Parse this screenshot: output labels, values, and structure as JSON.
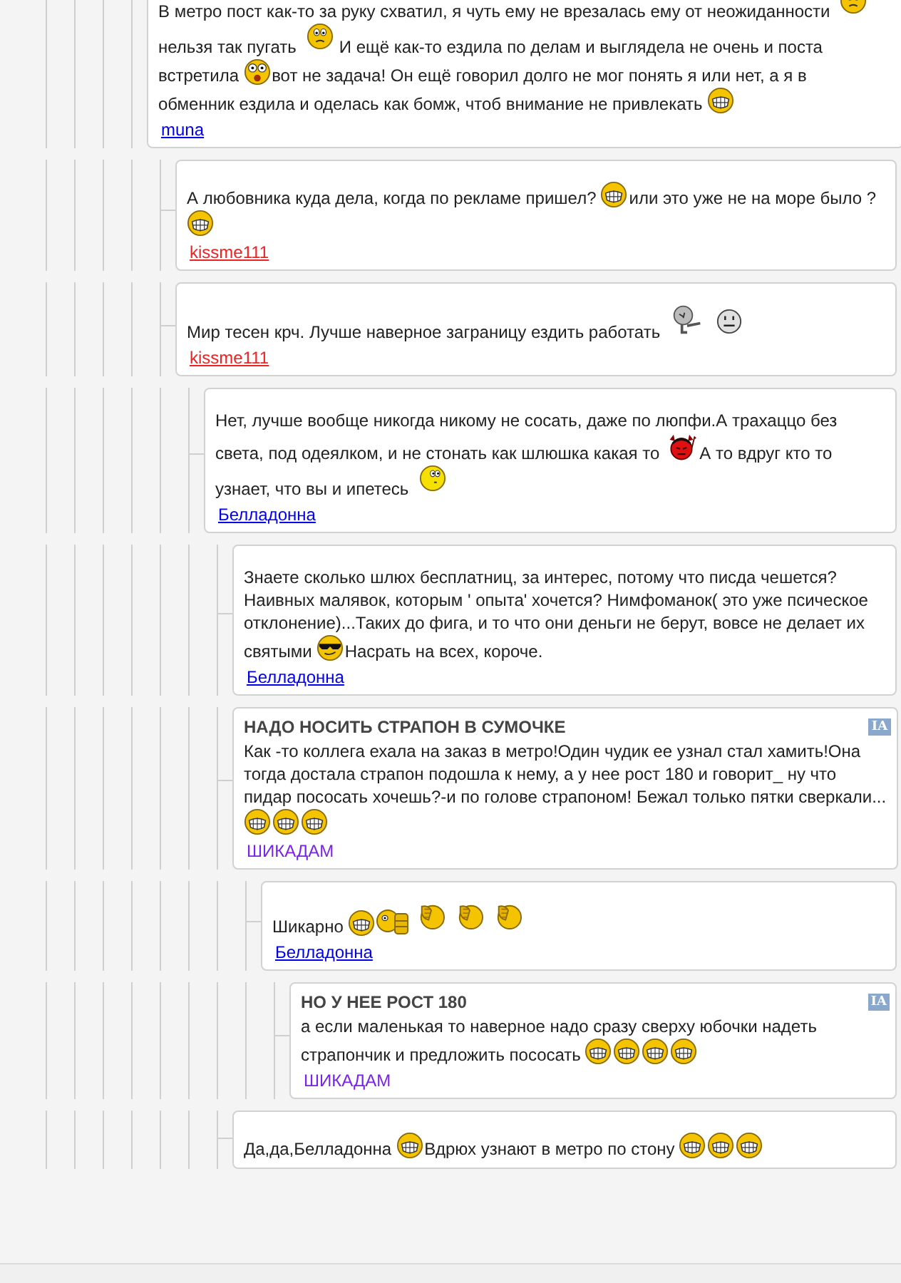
{
  "posts": [
    {
      "message": [
        {
          "kind": "text",
          "text": "В метро пост как-то за руку схватил, я чуть ему не врезалась ему от неожиданности"
        },
        {
          "kind": "worried"
        },
        {
          "kind": "text",
          "text": "нельзя так пугать"
        },
        {
          "kind": "worried"
        },
        {
          "kind": "text",
          "text": "И ещё как-то ездила по делам и выглядела не очень и поста"
        },
        {
          "kind": "text",
          "text": "встретила"
        },
        {
          "kind": "shocked"
        },
        {
          "kind": "text",
          "text": "вот не задача! Он ещё говорил долго не мог понять я или нет, а я в"
        },
        {
          "kind": "text",
          "text": "обменник ездила и оделась как бомж, чтоб внимание не привлекать"
        },
        {
          "kind": "grin"
        }
      ],
      "author": {
        "name": "muna",
        "color": "#0000ee",
        "underlined": true
      },
      "children": [
        {
          "message": [
            {
              "kind": "text",
              "text": "А любовника куда дела, когда по рекламе пришел?"
            },
            {
              "kind": "grin"
            },
            {
              "kind": "text",
              "text": "или это уже не на море было ?"
            },
            {
              "kind": "grin"
            }
          ],
          "author": {
            "name": "kissme111",
            "color": "#ee2222",
            "underlined": true
          }
        },
        {
          "message": [
            {
              "kind": "text",
              "text": "Мир тесен крч. Лучше наверное заграницу ездить работать"
            },
            {
              "kind": "pointing"
            },
            {
              "kind": "neutral"
            }
          ],
          "author": {
            "name": "kissme111",
            "color": "#ee2222",
            "underlined": true
          },
          "children": [
            {
              "message": [
                {
                  "kind": "text",
                  "text": "Нет, лучше вообще никогда никому не сосать, даже по люпфи.А трахаццо без"
                },
                {
                  "kind": "text",
                  "text": "света, под одеялком, и не стонать как шлюшка какая то"
                },
                {
                  "kind": "devil"
                },
                {
                  "kind": "text",
                  "text": "А то вдруг кто то"
                },
                {
                  "kind": "text",
                  "text": "узнает, что вы и ипетесь"
                },
                {
                  "kind": "thinking"
                }
              ],
              "author": {
                "name": "Белладонна",
                "color": "#0000ee",
                "underlined": true
              },
              "children": [
                {
                  "message": [
                    {
                      "kind": "text",
                      "text": "Знаете сколько шлюх бесплатниц, за интерес, потому что писда чешется?"
                    },
                    {
                      "kind": "text",
                      "text": "Наивных малявок, которым ' опыта' хочется? Нимфоманок( это уже псическое"
                    },
                    {
                      "kind": "text",
                      "text": "отклонение)...Таких до фига, и то что они деньги не берут, вовсе не делает их"
                    },
                    {
                      "kind": "text",
                      "text": "святыми"
                    },
                    {
                      "kind": "cool"
                    },
                    {
                      "kind": "text",
                      "text": "Насрать на всех, короче."
                    }
                  ],
                  "author": {
                    "name": "Белладонна",
                    "color": "#0000ee",
                    "underlined": true
                  }
                },
                {
                  "title": "НАДО НОСИТЬ СТРАПОН В СУМОЧКЕ",
                  "badge": "IA",
                  "message": [
                    {
                      "kind": "text",
                      "text": "Как -то коллега ехала на заказ в метро!Один чудик ее узнал стал хамить!Она"
                    },
                    {
                      "kind": "text",
                      "text": "тогда достала страпон подошла к нему, а у нее рост 180 и говорит_ ну что"
                    },
                    {
                      "kind": "text",
                      "text": "пидар пососать хочешь?-и по голове страпоном! Бежал только пятки сверкали..."
                    },
                    {
                      "kind": "grin"
                    },
                    {
                      "kind": "grin"
                    },
                    {
                      "kind": "grin"
                    }
                  ],
                  "author": {
                    "name": "ШИКАДАМ",
                    "color": "#7a22ee",
                    "underlined": false
                  },
                  "children": [
                    {
                      "message": [
                        {
                          "kind": "text",
                          "text": "Шикарно"
                        },
                        {
                          "kind": "grin"
                        },
                        {
                          "kind": "drinking"
                        },
                        {
                          "kind": "facepalm"
                        },
                        {
                          "kind": "facepalm"
                        },
                        {
                          "kind": "facepalm"
                        }
                      ],
                      "author": {
                        "name": "Белладонна",
                        "color": "#0000ee",
                        "underlined": true
                      },
                      "children": [
                        {
                          "title": "НО У НЕЕ РОСТ 180",
                          "badge": "IA",
                          "message": [
                            {
                              "kind": "text",
                              "text": "а если маленькая то наверное надо сразу сверху юбочки надеть"
                            },
                            {
                              "kind": "text",
                              "text": "страпончик и предложить пососать"
                            },
                            {
                              "kind": "grin"
                            },
                            {
                              "kind": "grin"
                            },
                            {
                              "kind": "grin"
                            },
                            {
                              "kind": "grin"
                            }
                          ],
                          "author": {
                            "name": "ШИКАДАМ",
                            "color": "#7a22ee",
                            "underlined": false
                          }
                        }
                      ]
                    }
                  ]
                },
                {
                  "message": [
                    {
                      "kind": "text",
                      "text": "Да,да,Белладонна"
                    },
                    {
                      "kind": "grin"
                    },
                    {
                      "kind": "text",
                      "text": "Вдрюх узнают в метро по стону"
                    },
                    {
                      "kind": "grin"
                    },
                    {
                      "kind": "grin"
                    },
                    {
                      "kind": "grin"
                    }
                  ]
                }
              ]
            }
          ]
        }
      ]
    }
  ]
}
